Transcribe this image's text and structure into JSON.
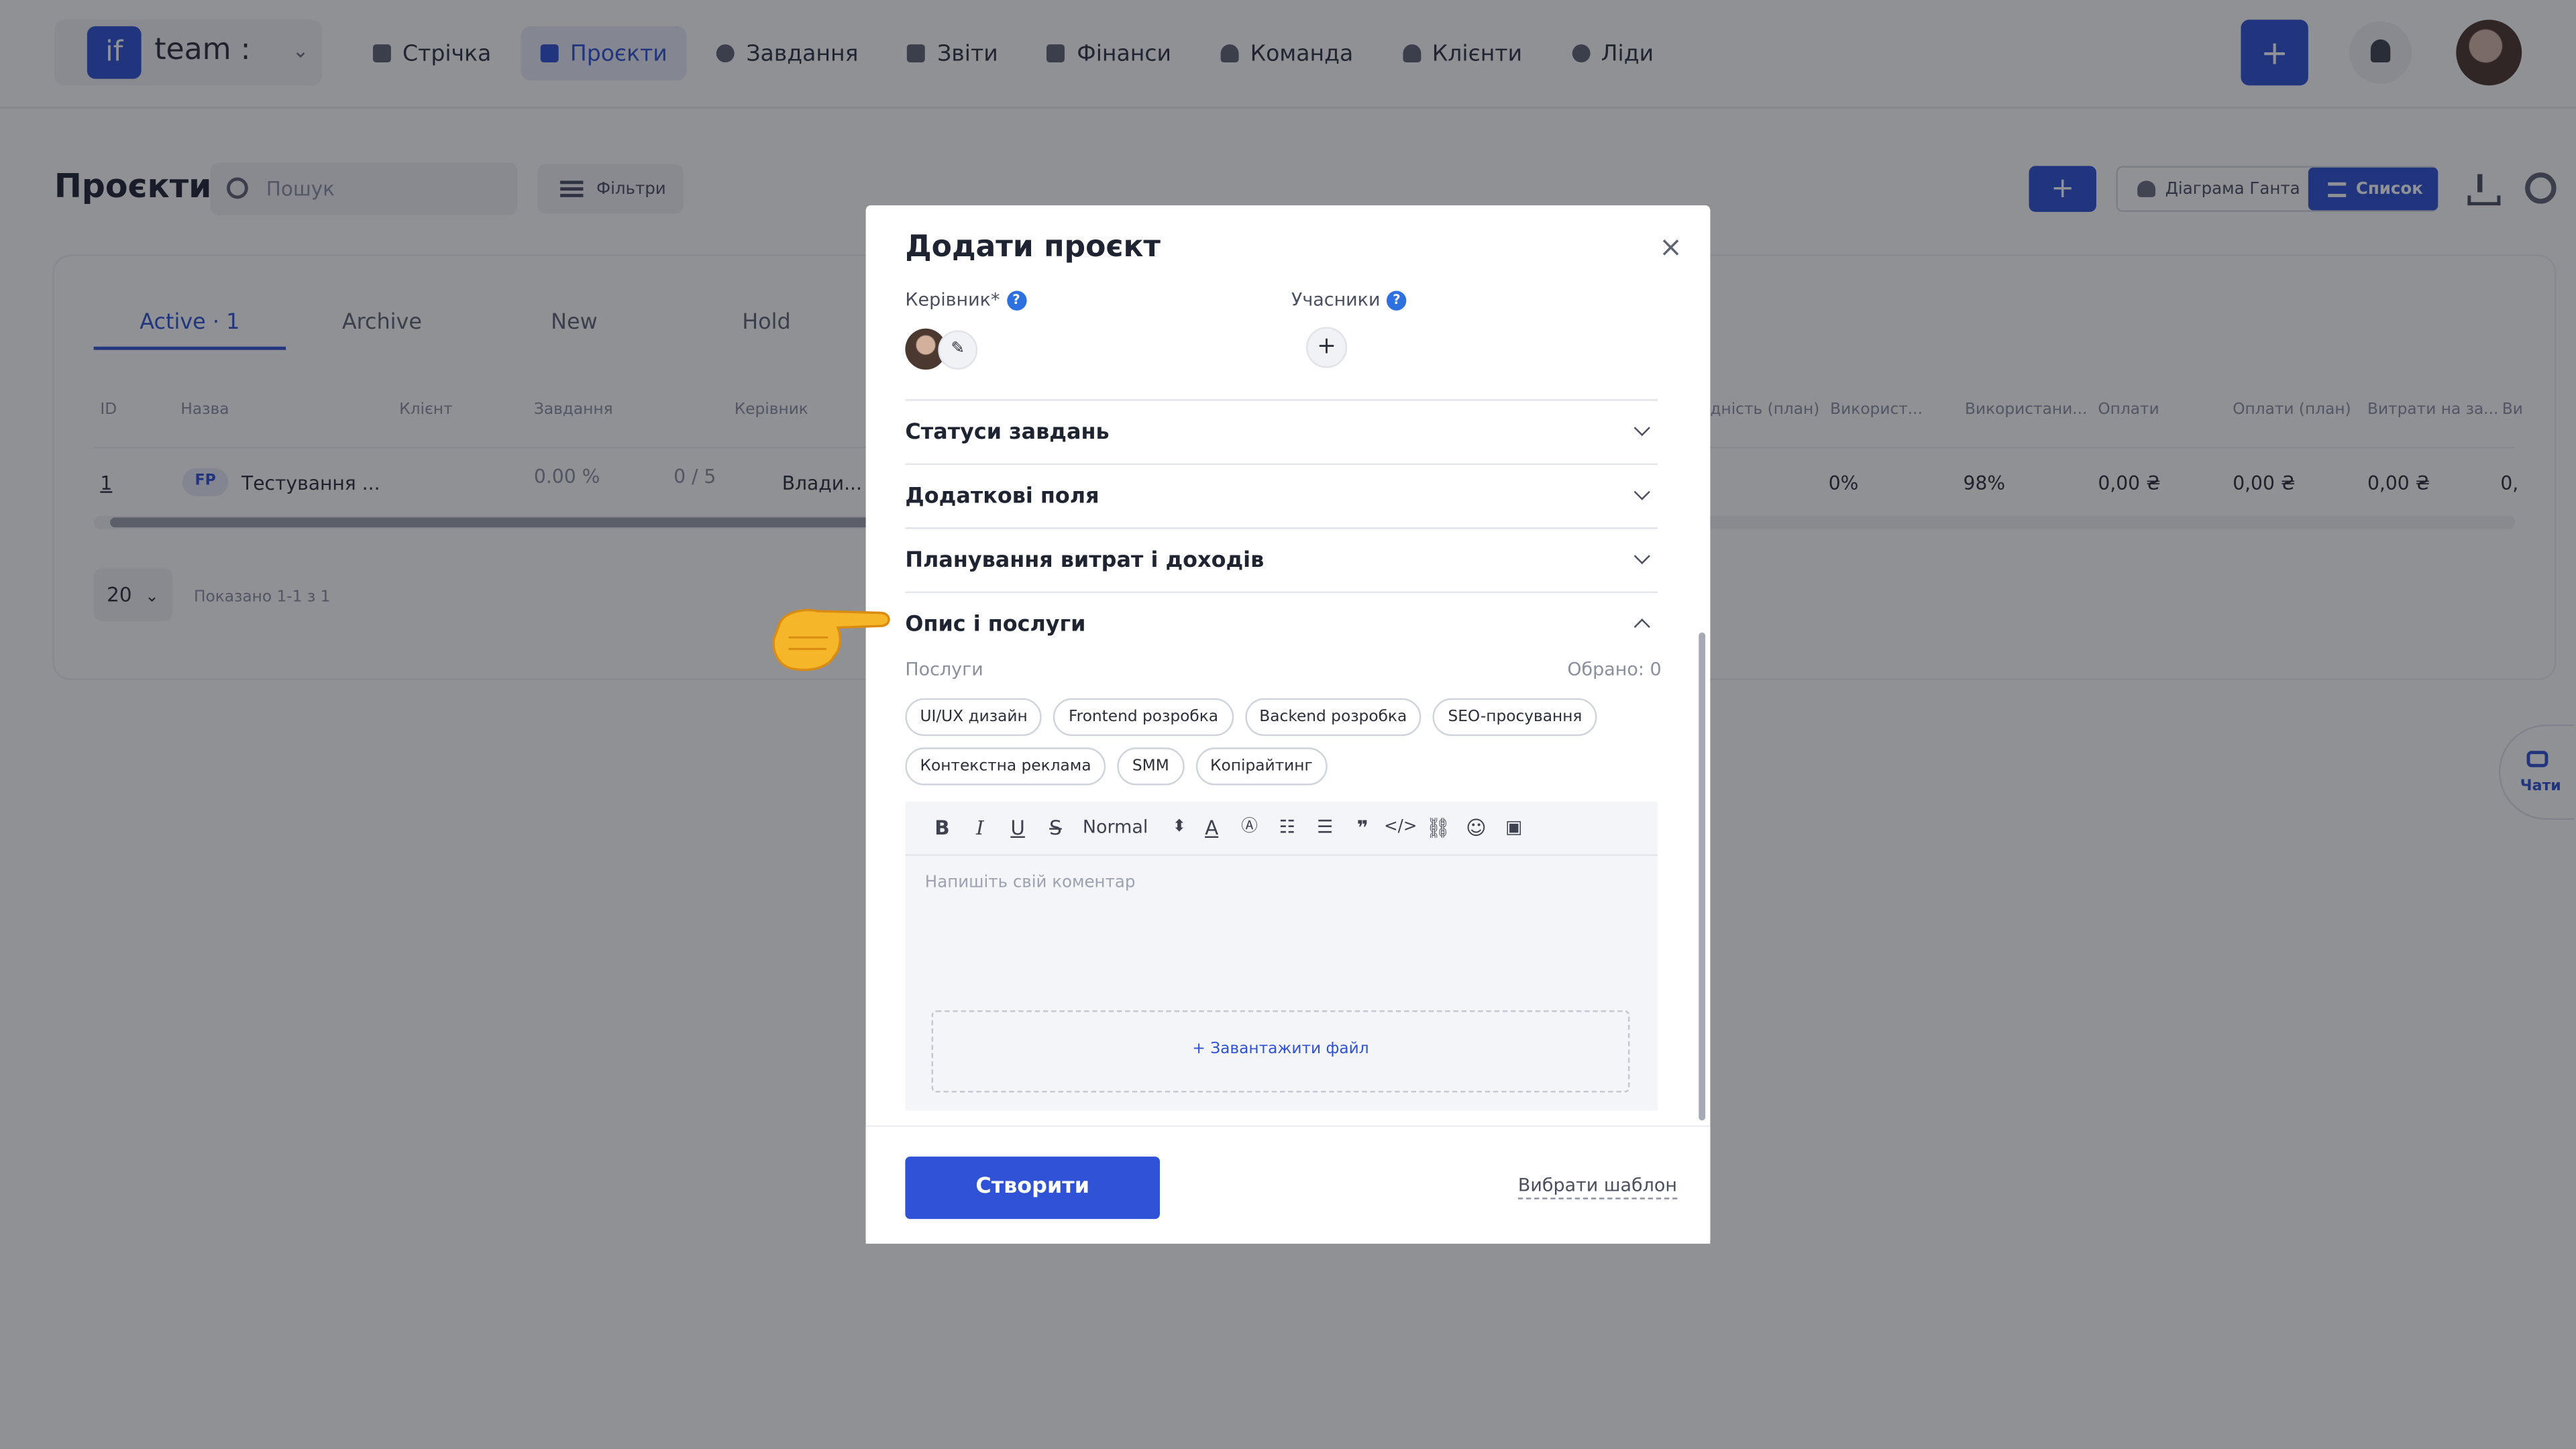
{
  "app": {
    "logo_badge": "if",
    "logo_text": "team :",
    "nav": [
      {
        "label": "Стрічка",
        "icon": "home-icon"
      },
      {
        "label": "Проєкти",
        "icon": "document-icon"
      },
      {
        "label": "Завдання",
        "icon": "check-circle-icon"
      },
      {
        "label": "Звіти",
        "icon": "report-icon"
      },
      {
        "label": "Фінанси",
        "icon": "wallet-icon"
      },
      {
        "label": "Команда",
        "icon": "user-icon"
      },
      {
        "label": "Клієнти",
        "icon": "users-icon"
      },
      {
        "label": "Ліди",
        "icon": "link-icon"
      }
    ],
    "active_nav": "Проєкти",
    "add_label": "+"
  },
  "page": {
    "title": "Проєкти",
    "search_placeholder": "Пошук",
    "filters_label": "Фільтри",
    "add_label": "+",
    "view_gantt": "Діаграма Ганта",
    "view_list": "Список"
  },
  "tabs": [
    "Active · 1",
    "Archive",
    "New",
    "Hold"
  ],
  "table": {
    "columns": [
      "ID",
      "Назва",
      "Клієнт",
      "Завдання",
      "Керівник",
      "дність (план)",
      "Використ...",
      "Використани...",
      "Оплати",
      "Оплати (план)",
      "Витрати на за...",
      "Ви"
    ],
    "row": {
      "id": "1",
      "badge": "FP",
      "name": "Тестування ...",
      "progress": "0.00 %",
      "tasks": "0 / 5",
      "manager": "Влади...",
      "used": "0%",
      "used_plan": "98%",
      "payments": "0,00 ₴",
      "payments_plan": "0,00 ₴",
      "expenses": "0,00 ₴",
      "more": "0,"
    },
    "per_page": "20",
    "shown_text": "Показано 1-1 з 1"
  },
  "chat_label": "Чати",
  "modal": {
    "title": "Додати проєкт",
    "close": "×",
    "manager_label": "Керівник*",
    "members_label": "Учасники",
    "help": "?",
    "add_member": "+",
    "sections": [
      {
        "title": "Статуси завдань",
        "expanded": false
      },
      {
        "title": "Додаткові поля",
        "expanded": false
      },
      {
        "title": "Планування витрат і доходів",
        "expanded": false
      },
      {
        "title": "Опис і послуги",
        "expanded": true
      }
    ],
    "services_label": "Послуги",
    "services_count": "Обрано: 0",
    "services": [
      "UI/UX дизайн",
      "Frontend розробка",
      "Backend розробка",
      "SEO-просування",
      "Контекстна реклама",
      "SMM",
      "Копірайтинг"
    ],
    "editor": {
      "format": "Normal",
      "placeholder": "Напишіть свій коментар",
      "upload": "+ Завантажити файл"
    },
    "create_label": "Створити",
    "template_label": "Вибрати шаблон"
  },
  "colors": {
    "accent": "#2f52d6",
    "overlay": "rgba(20,22,30,0.47)"
  }
}
